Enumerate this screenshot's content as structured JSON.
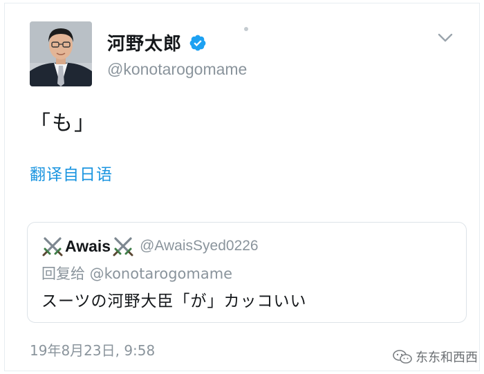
{
  "tweet": {
    "display_name": "河野太郎",
    "handle": "@konotarogomame",
    "text": "「も」",
    "translate_label": "翻译自日语",
    "timestamp": "19年8月23日, 9:58"
  },
  "quoted_tweet": {
    "display_name": "Awais",
    "handle": "@AwaisSyed0226",
    "reply_to": "回复给 @konotarogomame",
    "text": "スーツの河野大臣「が」カッコいい"
  },
  "watermark": {
    "label": "东东和西西"
  },
  "colors": {
    "link": "#1b95e0",
    "secondary_text": "#8a949c",
    "verified": "#1da1f2",
    "border": "#dde3e8"
  },
  "icons": {
    "verified": "verified-badge-icon",
    "caret": "chevron-down-icon",
    "swords": "crossed-swords-icon",
    "watermark_logo": "wechat-logo-icon"
  }
}
